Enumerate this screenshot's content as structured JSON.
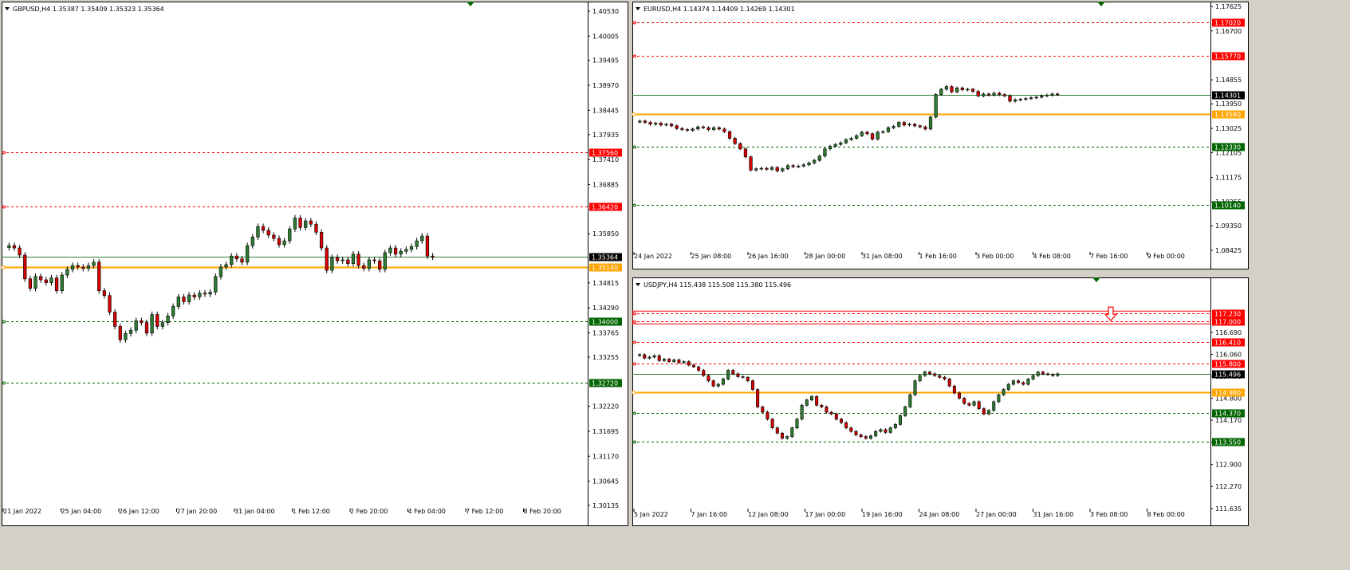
{
  "colors": {
    "bull": "#2e7d32",
    "bear": "#d50000",
    "outline": "#000000",
    "support": "#ffa500",
    "current": "#2e7d32",
    "resistance": "#ff0000",
    "target": "#006400",
    "axis_bg": "#ffffff"
  },
  "chart_data": [
    {
      "type": "candlestick",
      "header": "GBPUSD,H4  1.35387 1.35409 1.35323 1.35364",
      "ylim": [
        1.30135,
        1.4053
      ],
      "y_ticks": [
        "1.40530",
        "1.40005",
        "1.39495",
        "1.38970",
        "1.38445",
        "1.37935",
        "1.37410",
        "1.36885",
        "1.35850",
        "1.34815",
        "1.34290",
        "1.33765",
        "1.33255",
        "1.32220",
        "1.31695",
        "1.31170",
        "1.30645",
        "1.30135"
      ],
      "x_ticks": [
        "21 Jan 2022",
        "25 Jan 04:00",
        "26 Jan 12:00",
        "27 Jan 20:00",
        "31 Jan 04:00",
        "1 Feb 12:00",
        "2 Feb 20:00",
        "4 Feb 04:00",
        "7 Feb 12:00",
        "8 Feb 20:00"
      ],
      "levels": [
        {
          "value": 1.3756,
          "label": "1.37560",
          "kind": "resistance"
        },
        {
          "value": 1.3642,
          "label": "1.36420",
          "kind": "resistance"
        },
        {
          "value": 1.35364,
          "label": "1.35364",
          "kind": "current"
        },
        {
          "value": 1.3514,
          "label": "1.35140",
          "kind": "support"
        },
        {
          "value": 1.34,
          "label": "1.34000",
          "kind": "target"
        },
        {
          "value": 1.3272,
          "label": "1.32720",
          "kind": "target"
        }
      ],
      "closes": [
        1.356,
        1.3555,
        1.354,
        1.349,
        1.347,
        1.3495,
        1.3488,
        1.3482,
        1.3492,
        1.3465,
        1.3498,
        1.351,
        1.3518,
        1.3515,
        1.3512,
        1.3518,
        1.3525,
        1.3465,
        1.3455,
        1.342,
        1.339,
        1.3362,
        1.3375,
        1.3382,
        1.3402,
        1.3398,
        1.3376,
        1.3415,
        1.339,
        1.3398,
        1.3412,
        1.3432,
        1.3452,
        1.3442,
        1.3456,
        1.3452,
        1.346,
        1.3458,
        1.3462,
        1.3495,
        1.3515,
        1.352,
        1.3538,
        1.3532,
        1.3525,
        1.356,
        1.3578,
        1.36,
        1.3592,
        1.3582,
        1.3575,
        1.3562,
        1.357,
        1.3595,
        1.3618,
        1.3598,
        1.3612,
        1.3605,
        1.3588,
        1.3555,
        1.3508,
        1.3535,
        1.3528,
        1.353,
        1.3522,
        1.3542,
        1.3518,
        1.3512,
        1.353,
        1.3528,
        1.351,
        1.3545,
        1.3555,
        1.3542,
        1.3548,
        1.3552,
        1.3558,
        1.357,
        1.358,
        1.3538,
        1.3536
      ]
    },
    {
      "type": "candlestick",
      "header": "EURUSD,H4  1.14374 1.14409 1.14269 1.14301",
      "ylim": [
        1.08425,
        1.17625
      ],
      "y_ticks": [
        "1.17625",
        "1.16700",
        "1.14855",
        "1.13950",
        "1.13025",
        "1.12105",
        "1.11175",
        "1.10255",
        "1.09350",
        "1.08425"
      ],
      "x_ticks": [
        "24 Jan 2022",
        "25 Jan 08:00",
        "26 Jan 16:00",
        "28 Jan 00:00",
        "31 Jan 08:00",
        "1 Feb 16:00",
        "3 Feb 00:00",
        "4 Feb 08:00",
        "7 Feb 16:00",
        "9 Feb 00:00"
      ],
      "levels": [
        {
          "value": 1.1702,
          "label": "1.17020",
          "kind": "resistance"
        },
        {
          "value": 1.1577,
          "label": "1.15770",
          "kind": "resistance"
        },
        {
          "value": 1.14301,
          "label": "1.14301",
          "kind": "current"
        },
        {
          "value": 1.1358,
          "label": "1.13580",
          "kind": "support"
        },
        {
          "value": 1.1233,
          "label": "1.12330",
          "kind": "target"
        },
        {
          "value": 1.1014,
          "label": "1.10140",
          "kind": "target"
        }
      ],
      "closes": [
        1.133,
        1.1325,
        1.1318,
        1.1322,
        1.1315,
        1.1318,
        1.1312,
        1.1302,
        1.1298,
        1.1295,
        1.13,
        1.1308,
        1.1305,
        1.1298,
        1.1305,
        1.13,
        1.129,
        1.1265,
        1.1245,
        1.1225,
        1.1195,
        1.1145,
        1.115,
        1.1152,
        1.1148,
        1.1155,
        1.1142,
        1.115,
        1.1162,
        1.1158,
        1.116,
        1.1165,
        1.1172,
        1.1182,
        1.1198,
        1.1225,
        1.1235,
        1.1242,
        1.1248,
        1.126,
        1.1265,
        1.1275,
        1.1288,
        1.1282,
        1.1262,
        1.1288,
        1.129,
        1.1305,
        1.131,
        1.1325,
        1.1315,
        1.1318,
        1.1312,
        1.1308,
        1.13,
        1.1345,
        1.143,
        1.145,
        1.146,
        1.144,
        1.1455,
        1.1448,
        1.145,
        1.1442,
        1.1425,
        1.1432,
        1.1428,
        1.1435,
        1.143,
        1.1425,
        1.1405,
        1.141,
        1.1412,
        1.1415,
        1.1418,
        1.142,
        1.1425,
        1.1428,
        1.1432,
        1.143
      ]
    },
    {
      "type": "candlestick",
      "header": "USDJPY,H4  115.438 115.508 115.380 115.496",
      "ylim": [
        111.635,
        117.99
      ],
      "y_ticks": [
        "116.690",
        "116.060",
        "115.430",
        "114.800",
        "114.170",
        "113.540",
        "112.900",
        "112.270",
        "111.635"
      ],
      "x_ticks": [
        "5 Jan 2022",
        "7 Jan 16:00",
        "12 Jan 08:00",
        "17 Jan 00:00",
        "19 Jan 16:00",
        "24 Jan 08:00",
        "27 Jan 00:00",
        "31 Jan 16:00",
        "3 Feb 08:00",
        "8 Feb 00:00"
      ],
      "levels": [
        {
          "value": 117.23,
          "label": "117.230",
          "kind": "resistance"
        },
        {
          "value": 117.0,
          "label": "117.000",
          "kind": "resistance"
        },
        {
          "value": 116.41,
          "label": "116.410",
          "kind": "resistance"
        },
        {
          "value": 115.8,
          "label": "115.800",
          "kind": "resistance"
        },
        {
          "value": 115.496,
          "label": "115.496",
          "kind": "current"
        },
        {
          "value": 114.98,
          "label": "114.980",
          "kind": "support"
        },
        {
          "value": 114.37,
          "label": "114.370",
          "kind": "target"
        },
        {
          "value": 113.55,
          "label": "113.550",
          "kind": "target"
        }
      ],
      "closes": [
        116.05,
        115.95,
        115.98,
        116.02,
        115.88,
        115.92,
        115.85,
        115.9,
        115.82,
        115.85,
        115.75,
        115.7,
        115.6,
        115.45,
        115.3,
        115.15,
        115.2,
        115.35,
        115.6,
        115.5,
        115.42,
        115.4,
        115.3,
        115.05,
        114.55,
        114.4,
        114.2,
        113.95,
        113.8,
        113.65,
        113.7,
        113.95,
        114.2,
        114.6,
        114.75,
        114.85,
        114.6,
        114.55,
        114.4,
        114.35,
        114.2,
        114.1,
        113.95,
        113.85,
        113.75,
        113.7,
        113.65,
        113.72,
        113.85,
        113.9,
        113.82,
        113.95,
        114.05,
        114.3,
        114.55,
        114.9,
        115.3,
        115.45,
        115.55,
        115.5,
        115.45,
        115.4,
        115.35,
        115.15,
        114.95,
        114.8,
        114.65,
        114.6,
        114.7,
        114.5,
        114.35,
        114.45,
        114.7,
        114.9,
        115.05,
        115.2,
        115.3,
        115.25,
        115.2,
        115.35,
        115.45,
        115.55,
        115.5,
        115.48,
        115.45,
        115.5
      ]
    }
  ]
}
